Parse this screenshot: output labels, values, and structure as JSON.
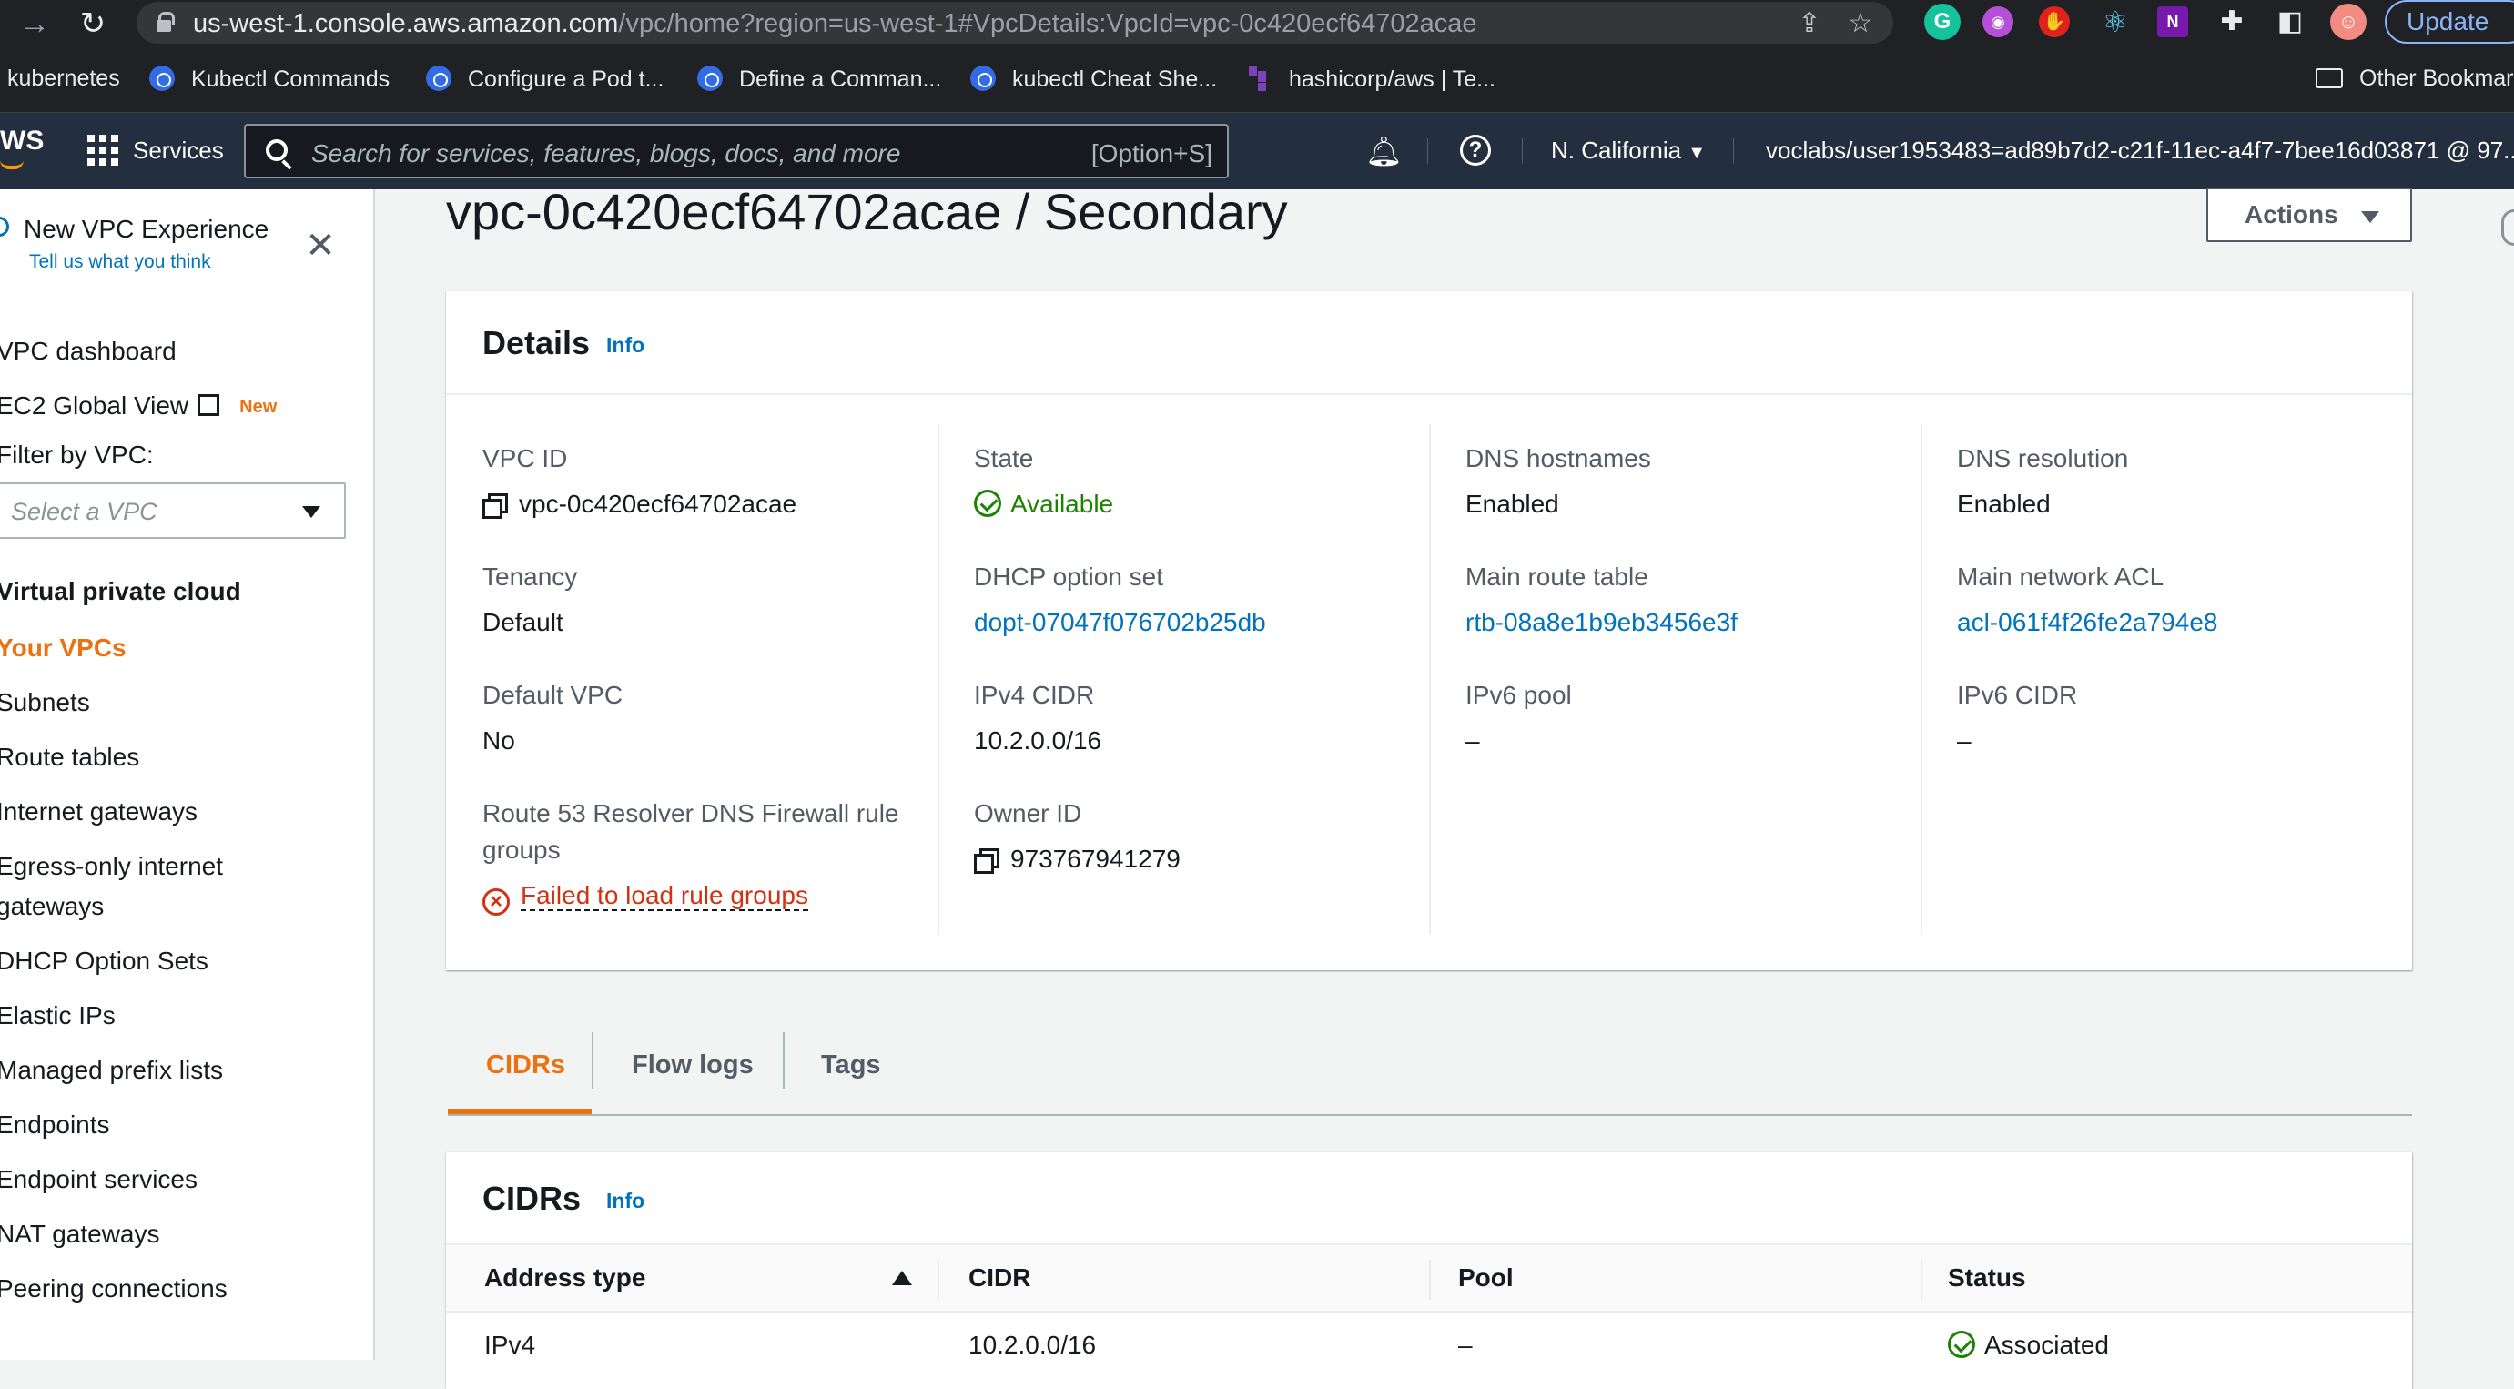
{
  "browser": {
    "url_host": "us-west-1.console.aws.amazon.com",
    "url_path": "/vpc/home?region=us-west-1#VpcDetails:VpcId=vpc-0c420ecf64702acae",
    "update_label": "Update",
    "bookmarks": [
      {
        "label": "kubernetes"
      },
      {
        "label": "Kubectl Commands"
      },
      {
        "label": "Configure a Pod t..."
      },
      {
        "label": "Define a Comman..."
      },
      {
        "label": "kubectl Cheat She..."
      },
      {
        "label": "hashicorp/aws | Te..."
      }
    ],
    "other_bookmarks": "Other Bookmar",
    "extension_icons": [
      "grammarly-icon",
      "pocket-icon",
      "adblock-icon",
      "react-devtools-icon",
      "onenote-icon",
      "puzzle-icon",
      "sidepanel-icon",
      "profile-avatar-icon"
    ]
  },
  "aws_header": {
    "logo": "WS",
    "services_label": "Services",
    "search_placeholder": "Search for services, features, blogs, docs, and more",
    "search_shortcut": "[Option+S]",
    "region": "N. California",
    "account": "voclabs/user1953483=ad89b7d2-c21f-11ec-a4f7-7bee16d03871 @ 97..."
  },
  "sidebar": {
    "new_experience_title": "New VPC Experience",
    "new_experience_link": "Tell us what you think",
    "vpc_dashboard": "VPC dashboard",
    "ec2_global_view": "EC2 Global View",
    "new_badge": "New",
    "filter_label": "Filter by VPC:",
    "filter_placeholder": "Select a VPC",
    "section_title": "Virtual private cloud",
    "items": [
      {
        "label": "Your VPCs",
        "active": true
      },
      {
        "label": "Subnets"
      },
      {
        "label": "Route tables"
      },
      {
        "label": "Internet gateways"
      },
      {
        "label": "Egress-only internet"
      },
      {
        "label": "gateways"
      },
      {
        "label": "DHCP Option Sets"
      },
      {
        "label": "Elastic IPs"
      },
      {
        "label": "Managed prefix lists"
      },
      {
        "label": "Endpoints"
      },
      {
        "label": "Endpoint services"
      },
      {
        "label": "NAT gateways"
      },
      {
        "label": "Peering connections"
      }
    ]
  },
  "page": {
    "title": "vpc-0c420ecf64702acae / Secondary",
    "actions_label": "Actions"
  },
  "details": {
    "title": "Details",
    "info": "Info",
    "vpc_id_label": "VPC ID",
    "vpc_id": "vpc-0c420ecf64702acae",
    "state_label": "State",
    "state": "Available",
    "dns_hostnames_label": "DNS hostnames",
    "dns_hostnames": "Enabled",
    "dns_resolution_label": "DNS resolution",
    "dns_resolution": "Enabled",
    "tenancy_label": "Tenancy",
    "tenancy": "Default",
    "dhcp_label": "DHCP option set",
    "dhcp": "dopt-07047f076702b25db",
    "main_route_label": "Main route table",
    "main_route": "rtb-08a8e1b9eb3456e3f",
    "main_acl_label": "Main network ACL",
    "main_acl": "acl-061f4f26fe2a794e8",
    "default_vpc_label": "Default VPC",
    "default_vpc": "No",
    "ipv4_cidr_label": "IPv4 CIDR",
    "ipv4_cidr": "10.2.0.0/16",
    "ipv6_pool_label": "IPv6 pool",
    "ipv6_pool": "–",
    "ipv6_cidr_label": "IPv6 CIDR",
    "ipv6_cidr": "–",
    "r53_label_line1": "Route 53 Resolver DNS Firewall rule",
    "r53_label_line2": "groups",
    "r53_value": "Failed to load rule groups",
    "owner_label": "Owner ID",
    "owner": "973767941279"
  },
  "tabs": [
    {
      "label": "CIDRs",
      "active": true
    },
    {
      "label": "Flow logs"
    },
    {
      "label": "Tags"
    }
  ],
  "cidrs": {
    "title": "CIDRs",
    "info": "Info",
    "columns": [
      "Address type",
      "CIDR",
      "Pool",
      "Status"
    ],
    "rows": [
      {
        "address_type": "IPv4",
        "cidr": "10.2.0.0/16",
        "pool": "–",
        "status": "Associated"
      }
    ]
  },
  "colors": {
    "aws_header": "#232f3e",
    "accent_orange": "#ec7211",
    "link_blue": "#0073bb",
    "success_green": "#1d8102",
    "error_red": "#d13212"
  }
}
